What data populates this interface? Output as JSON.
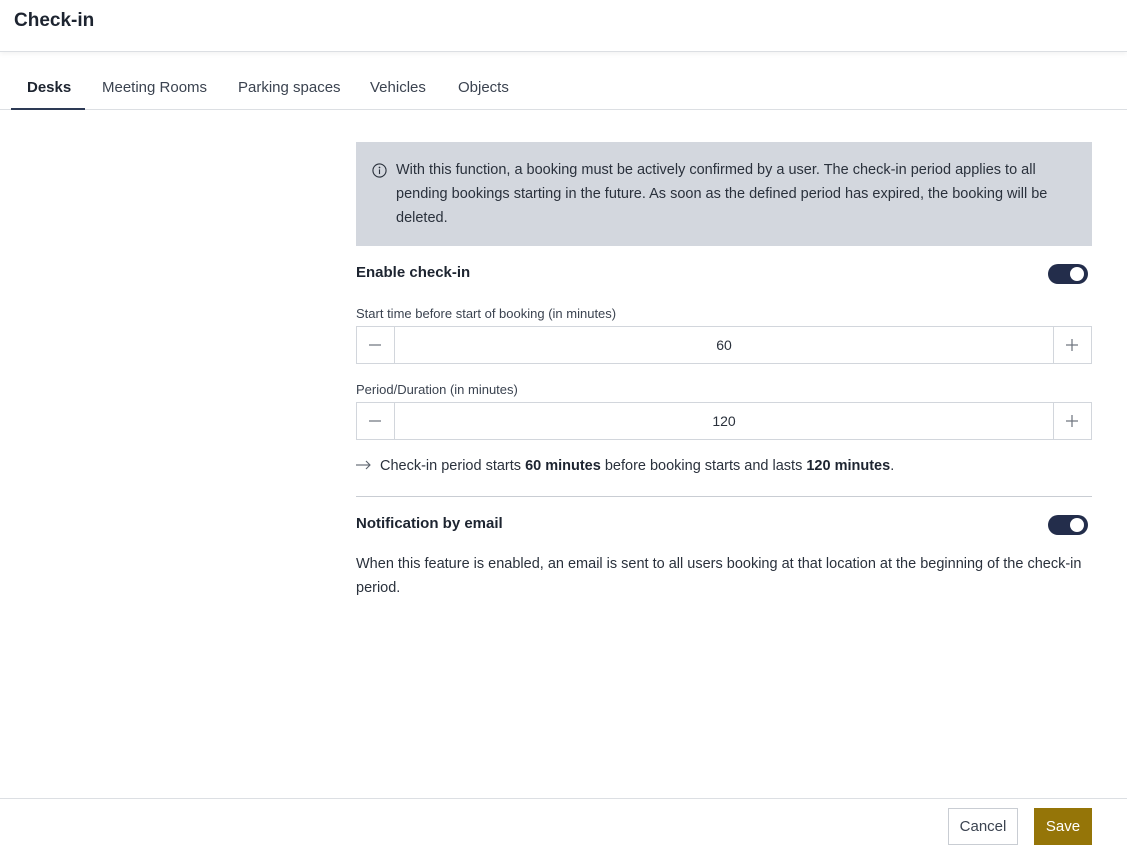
{
  "header": {
    "title": "Check-in"
  },
  "tabs": [
    {
      "label": "Desks",
      "active": true
    },
    {
      "label": "Meeting Rooms",
      "active": false
    },
    {
      "label": "Parking spaces",
      "active": false
    },
    {
      "label": "Vehicles",
      "active": false
    },
    {
      "label": "Objects",
      "active": false
    }
  ],
  "info": {
    "icon": "info-icon",
    "text": "With this function, a booking must be actively confirmed by a user. The check-in period applies to all pending bookings starting in the future. As soon as the defined period has expired, the booking will be deleted."
  },
  "check_in": {
    "label": "Enable check-in",
    "enabled": true,
    "start_time": {
      "label": "Start time before start of booking (in minutes)",
      "value": "60"
    },
    "duration": {
      "label": "Period/Duration (in minutes)",
      "value": "120"
    },
    "summary": {
      "prefix": "Check-in period starts",
      "start_bold": "60 minutes",
      "middle": "before booking starts and lasts",
      "duration_bold": "120 minutes",
      "suffix": "."
    }
  },
  "notification": {
    "label": "Notification by email",
    "enabled": true,
    "description": "When this feature is enabled, an email is sent to all users booking at that location at the beginning of the check-in period."
  },
  "footer": {
    "cancel_label": "Cancel",
    "save_label": "Save"
  },
  "colors": {
    "accent": "#232d4b",
    "save_button": "#957508",
    "info_background": "#d3d7de"
  }
}
